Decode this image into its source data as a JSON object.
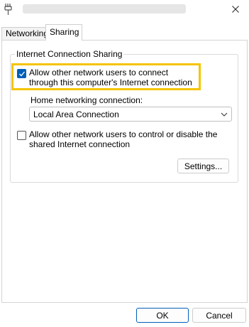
{
  "titlebar": {
    "close_icon": "close-icon"
  },
  "tabs": [
    {
      "label": "Networking",
      "active": false
    },
    {
      "label": "Sharing",
      "active": true
    }
  ],
  "ics": {
    "group_label": "Internet Connection Sharing",
    "allow_connect": {
      "label": "Allow other network users to connect through this computer's Internet connection",
      "checked": true
    },
    "home_networking": {
      "label": "Home networking connection:",
      "selected": "Local Area Connection"
    },
    "allow_control": {
      "label": "Allow other network users to control or disable the shared Internet connection",
      "checked": false
    },
    "settings_label": "Settings..."
  },
  "footer": {
    "ok_label": "OK",
    "cancel_label": "Cancel"
  },
  "colors": {
    "accent": "#005fb8",
    "highlight": "#f5c400"
  }
}
